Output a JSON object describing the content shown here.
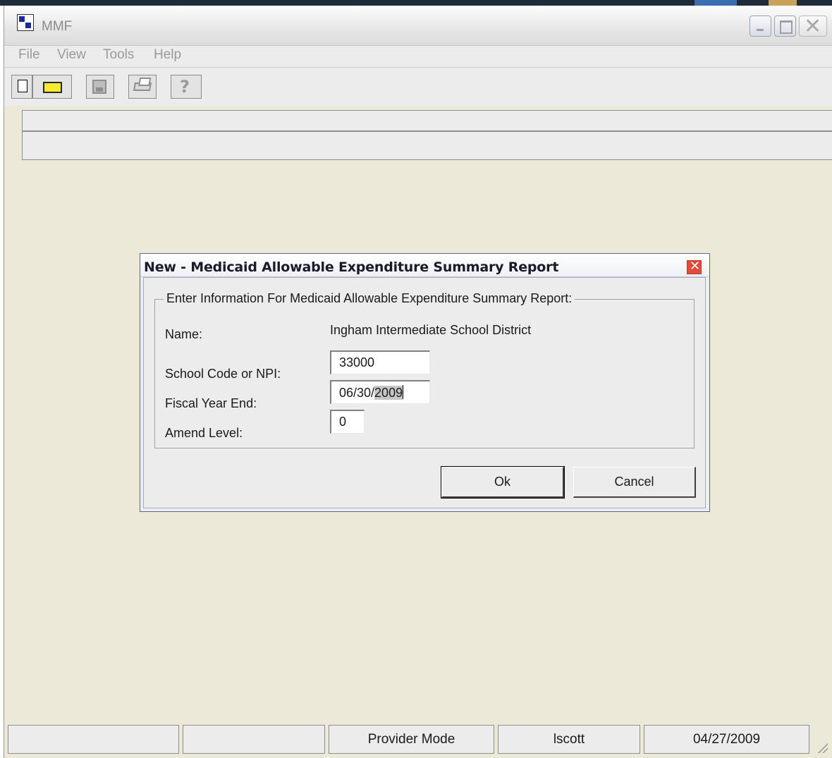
{
  "window": {
    "title": "MMF"
  },
  "menu": [
    "File",
    "View",
    "Tools",
    "Help"
  ],
  "toolbar": {
    "buttons": [
      "new-document-icon",
      "open-folder-icon",
      "save-icon",
      "print-icon",
      "help-icon"
    ],
    "help_glyph": "?"
  },
  "dialog": {
    "title": "New - Medicaid Allowable Expenditure Summary Report",
    "group_label": "Enter Information For Medicaid Allowable Expenditure Summary Report:",
    "name_label": "Name:",
    "name_value": "Ingham Intermediate School District",
    "school_code_label": "School Code or NPI:",
    "school_code_value": "33000",
    "fiscal_year_label": "Fiscal Year End:",
    "fiscal_year_value_unselected": "06/30/",
    "fiscal_year_value_selected": "2009",
    "amend_label": "Amend Level:",
    "amend_value": "0",
    "ok_label": "Ok",
    "cancel_label": "Cancel"
  },
  "status": {
    "panel1": "",
    "panel2": "",
    "mode": "Provider Mode",
    "user": "lscott",
    "date": "04/27/2009"
  }
}
